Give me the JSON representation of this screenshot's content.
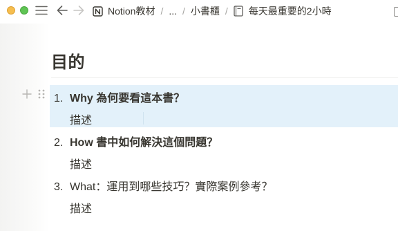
{
  "window": {
    "traffic_lights": [
      "yellow",
      "green"
    ]
  },
  "toolbar": {
    "menu_icon": "hamburger-menu-icon",
    "back_icon": "arrow-left-icon",
    "forward_icon": "arrow-right-icon"
  },
  "breadcrumb": {
    "workspace": "Notion教材",
    "ellipsis": "...",
    "parent": "小書櫃",
    "page": "每天最重要的2小時",
    "separator": "/"
  },
  "content": {
    "heading": "目的",
    "items": [
      {
        "number": "1.",
        "title": "Why 為何要看這本書？",
        "bold": true,
        "desc": "描述"
      },
      {
        "number": "2.",
        "title": "How 書中如何解決這個問題？",
        "bold": true,
        "desc": "描述"
      },
      {
        "number": "3.",
        "title": "What：運用到哪些技巧？實際案例參考？",
        "bold": false,
        "desc": "描述"
      }
    ]
  },
  "colors": {
    "text": "#37352f",
    "highlight": "#e3f1fa",
    "separator": "#a4a3a0"
  }
}
